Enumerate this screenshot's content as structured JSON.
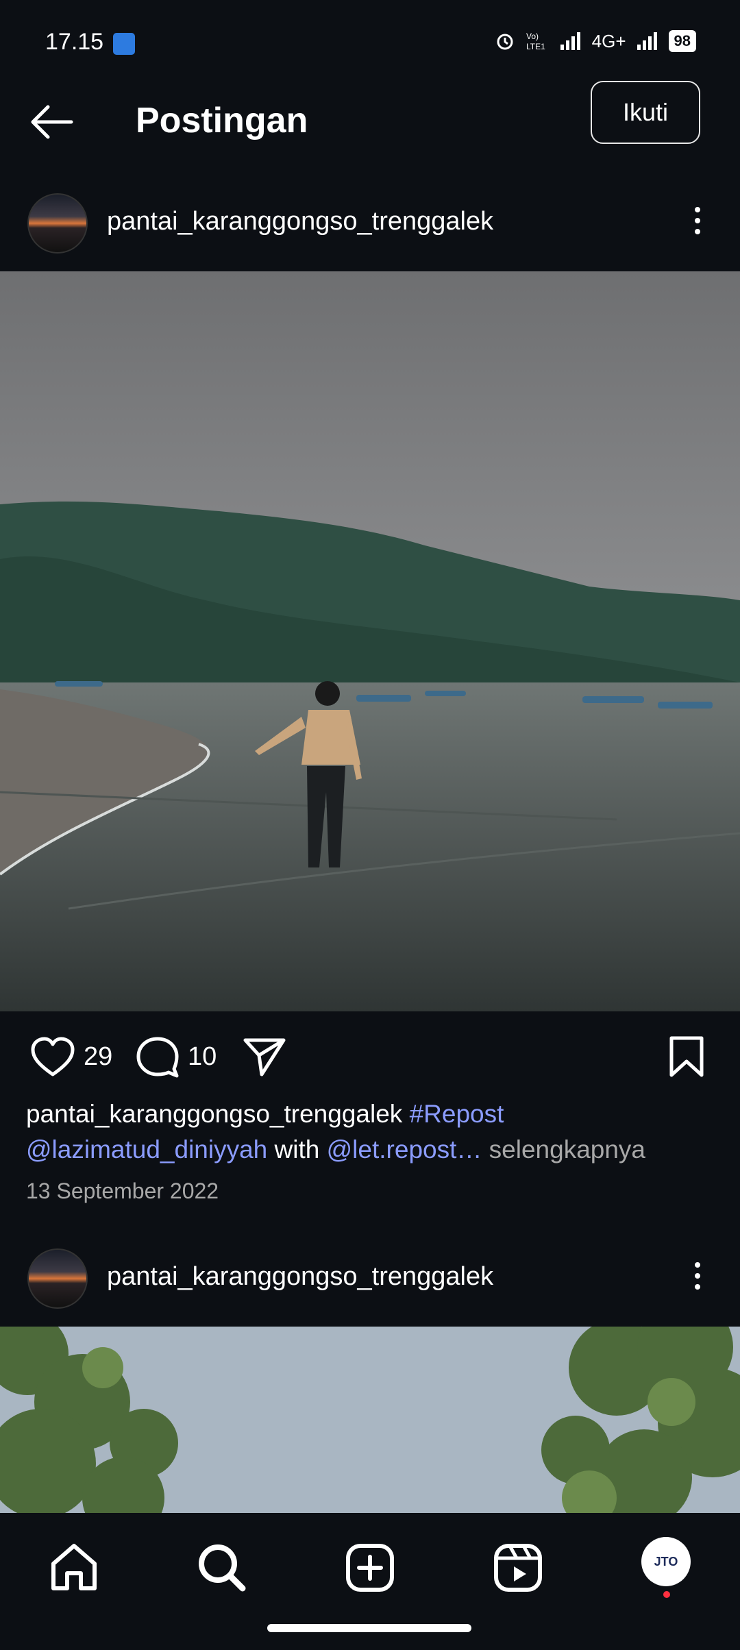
{
  "status_bar": {
    "time": "17.15",
    "network": "4G+",
    "battery": "98"
  },
  "header": {
    "title": "Postingan",
    "follow_label": "Ikuti"
  },
  "posts": [
    {
      "username": "pantai_karanggongso_trenggalek",
      "likes": "29",
      "comments": "10",
      "caption": {
        "author": "pantai_karanggongso_trenggalek",
        "hashtag": "#Repost",
        "mention1": "@lazimatud_diniyyah",
        "with_text": "with",
        "mention2": "@let.repost",
        "ellipsis": "…",
        "more": "selengkapnya"
      },
      "date": "13 September 2022"
    },
    {
      "username": "pantai_karanggongso_trenggalek"
    }
  ],
  "profile": {
    "avatar_text": "JTO"
  },
  "icons": {
    "back": "arrow-left-icon",
    "more": "more-vertical-icon",
    "like": "heart-icon",
    "comment": "comment-icon",
    "share": "send-icon",
    "save": "bookmark-icon",
    "home": "home-icon",
    "search": "search-icon",
    "create": "plus-square-icon",
    "reels": "reels-icon"
  }
}
